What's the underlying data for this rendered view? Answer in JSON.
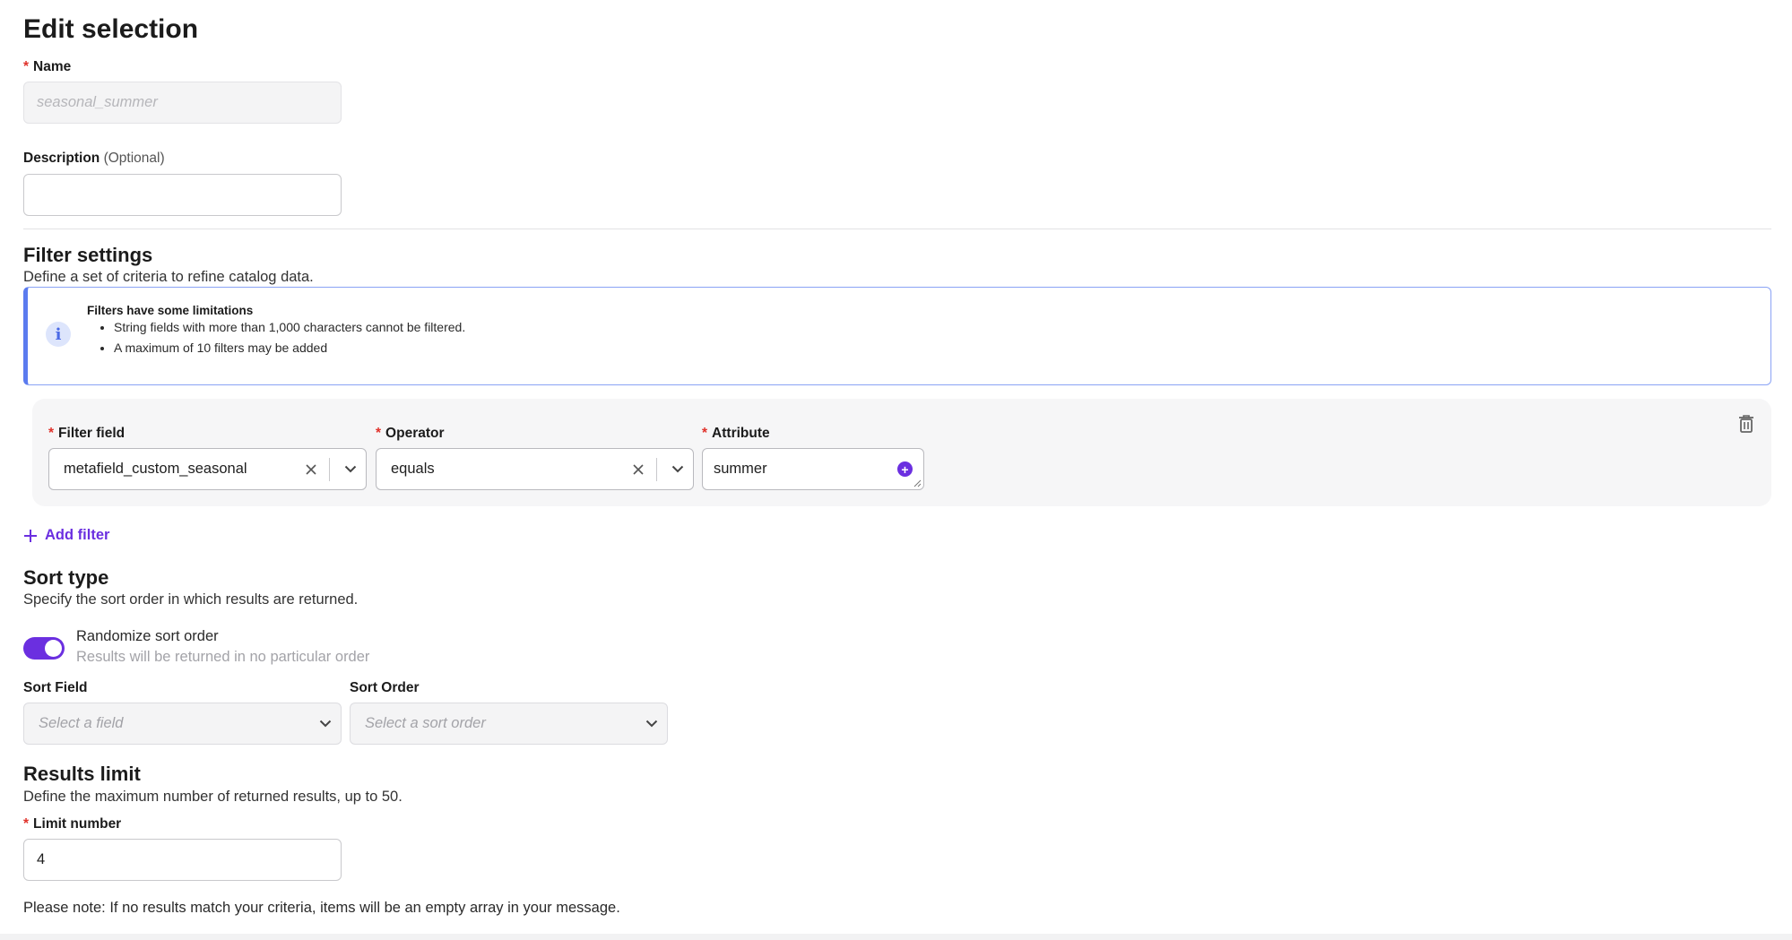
{
  "page": {
    "title": "Edit selection"
  },
  "name_field": {
    "label": "Name",
    "placeholder": "seasonal_summer"
  },
  "description_field": {
    "label": "Description",
    "optional": "(Optional)",
    "value": ""
  },
  "filter_settings": {
    "heading": "Filter settings",
    "description": "Define a set of criteria to refine catalog data.",
    "info": {
      "title": "Filters have some limitations",
      "items": [
        "String fields with more than 1,000 characters cannot be filtered.",
        "A maximum of 10 filters may be added"
      ]
    },
    "filter": {
      "field_label": "Filter field",
      "field_value": "metafield_custom_seasonal",
      "operator_label": "Operator",
      "operator_value": "equals",
      "attribute_label": "Attribute",
      "attribute_value": "summer"
    },
    "add_filter": "Add filter"
  },
  "sort": {
    "heading": "Sort type",
    "description": "Specify the sort order in which results are returned.",
    "toggle_label": "Randomize sort order",
    "toggle_help": "Results will be returned in no particular order",
    "toggle_on": true,
    "sort_field_label": "Sort Field",
    "sort_field_placeholder": "Select a field",
    "sort_order_label": "Sort Order",
    "sort_order_placeholder": "Select a sort order"
  },
  "results": {
    "heading": "Results limit",
    "description": "Define the maximum number of returned results, up to 50.",
    "limit_label": "Limit number",
    "limit_value": "4",
    "note": "Please note: If no results match your criteria, items will be an empty array in your message."
  },
  "colors": {
    "accent": "#6b2fe0",
    "info_border": "#5b7bef",
    "required": "#e0322b"
  }
}
